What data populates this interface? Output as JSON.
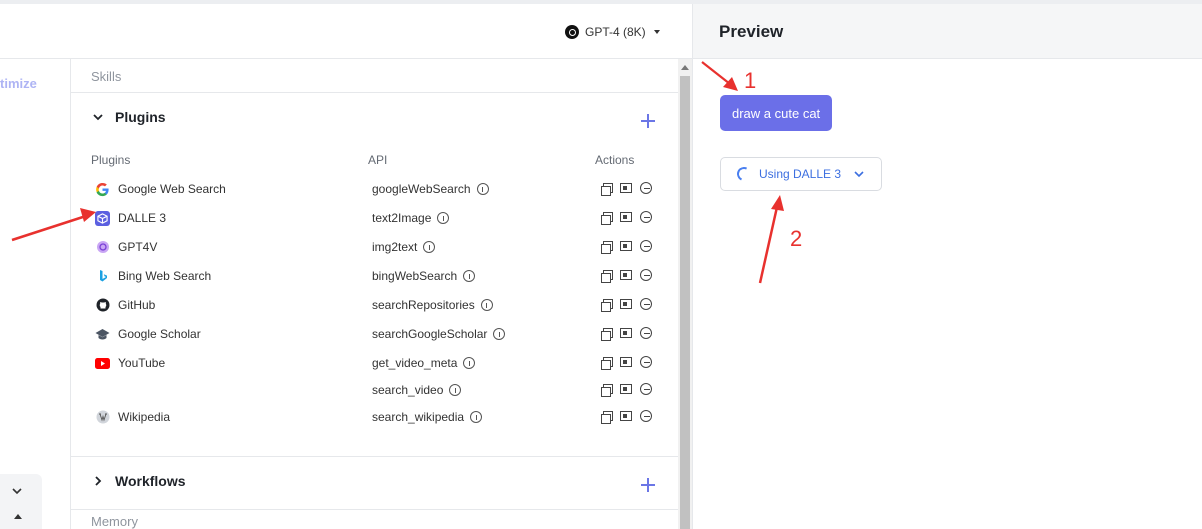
{
  "left_strip": {
    "optimize_label": "timize"
  },
  "header": {
    "model": "GPT-4 (8K)"
  },
  "config": {
    "skills_label": "Skills",
    "plugins_label": "Plugins",
    "columns": {
      "plugins": "Plugins",
      "api": "API",
      "actions": "Actions"
    },
    "rows": [
      {
        "plugin": "Google Web Search",
        "icon": "google-icon",
        "api": "googleWebSearch"
      },
      {
        "plugin": "DALLE 3",
        "icon": "dalle-icon",
        "api": "text2Image"
      },
      {
        "plugin": "GPT4V",
        "icon": "gpt4v-icon",
        "api": "img2text"
      },
      {
        "plugin": "Bing Web Search",
        "icon": "bing-icon",
        "api": "bingWebSearch"
      },
      {
        "plugin": "GitHub",
        "icon": "github-icon",
        "api": "searchRepositories"
      },
      {
        "plugin": "Google Scholar",
        "icon": "scholar-icon",
        "api": "searchGoogleScholar"
      },
      {
        "plugin": "YouTube",
        "icon": "youtube-icon",
        "api": "get_video_meta"
      },
      {
        "plugin": "",
        "icon": "",
        "api": "search_video"
      },
      {
        "plugin": "Wikipedia",
        "icon": "wikipedia-icon",
        "api": "search_wikipedia"
      }
    ],
    "workflows_label": "Workflows",
    "memory_label": "Memory"
  },
  "preview": {
    "title": "Preview",
    "user_message": "draw a cute cat",
    "tool_status": "Using DALLE 3"
  },
  "annotations": {
    "n1": "1",
    "n2": "2"
  },
  "colors": {
    "accent": "#6b6fe8",
    "tool_blue": "#3c6fe0",
    "annotation_red": "#e8312e"
  }
}
